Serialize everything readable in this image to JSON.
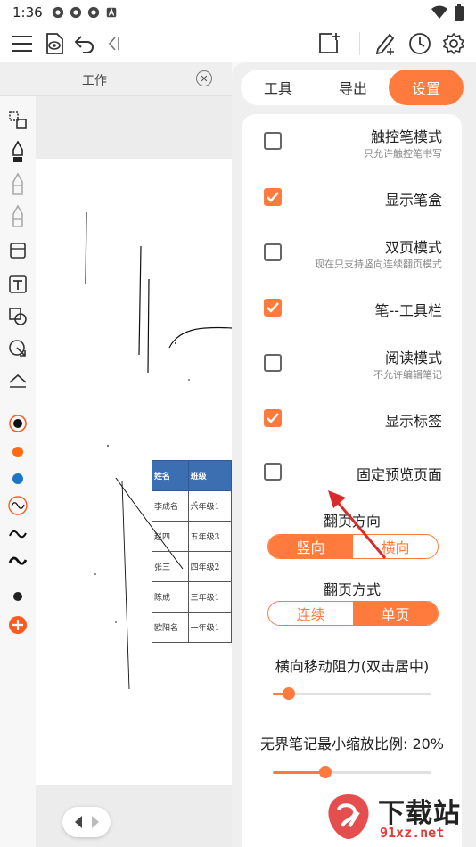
{
  "status_bar": {
    "time": "1:36"
  },
  "tabbar": {
    "tab_label": "工作"
  },
  "panel": {
    "tabs": [
      {
        "label": "工具",
        "active": false
      },
      {
        "label": "导出",
        "active": false
      },
      {
        "label": "设置",
        "active": true
      }
    ],
    "options": [
      {
        "title": "触控笔模式",
        "subtitle": "只允许触控笔书写",
        "checked": false
      },
      {
        "title": "显示笔盒",
        "subtitle": "",
        "checked": true
      },
      {
        "title": "双页模式",
        "subtitle": "现在只支持竖向连续翻页模式",
        "checked": false
      },
      {
        "title": "笔--工具栏",
        "subtitle": "",
        "checked": true
      },
      {
        "title": "阅读模式",
        "subtitle": "不允许编辑笔记",
        "checked": false
      },
      {
        "title": "显示标签",
        "subtitle": "",
        "checked": true
      },
      {
        "title": "固定预览页面",
        "subtitle": "",
        "checked": false
      }
    ],
    "page_direction": {
      "title": "翻页方向",
      "options": [
        "竖向",
        "横向"
      ],
      "selected": "竖向"
    },
    "page_mode": {
      "title": "翻页方式",
      "options": [
        "连续",
        "单页"
      ],
      "selected": "单页"
    },
    "horizontal_resistance": {
      "title": "横向移动阻力(双击居中)",
      "value": 0.1
    },
    "min_zoom": {
      "title": "无界笔记最小缩放比例: 20%",
      "value": 0.33
    }
  },
  "canvas_table": {
    "headers": [
      "姓名",
      "班级"
    ],
    "rows": [
      [
        "李成名",
        "六年级1"
      ],
      [
        "赵四",
        "五年级3"
      ],
      [
        "张三",
        "四年级2"
      ],
      [
        "陈成",
        "三年级1"
      ],
      [
        "欧阳名",
        "一年级1"
      ]
    ]
  },
  "watermark": {
    "title": "下载站",
    "domain": "91xz.net"
  },
  "colors": {
    "accent": "#ff7a3d",
    "table_header": "#3b6fb2",
    "arrow": "#d92b2b"
  }
}
